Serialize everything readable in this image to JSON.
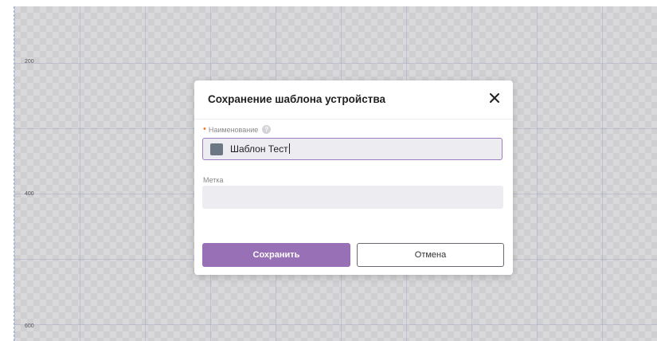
{
  "ruler": {
    "labels": [
      "200",
      "400",
      "600"
    ]
  },
  "dialog": {
    "title": "Сохранение шаблона устройства",
    "close_icon": "close-icon",
    "fields": {
      "name": {
        "label": "Наименование",
        "required": true,
        "help_icon": "help-circle-icon",
        "value": "Шаблон Тест",
        "swatch_color": "#6c7784"
      },
      "tag": {
        "label": "Метка",
        "value": "",
        "placeholder": ""
      }
    },
    "buttons": {
      "save_label": "Сохранить",
      "cancel_label": "Отмена"
    },
    "colors": {
      "primary": "#9870b5",
      "required_marker": "#f07a24"
    }
  }
}
